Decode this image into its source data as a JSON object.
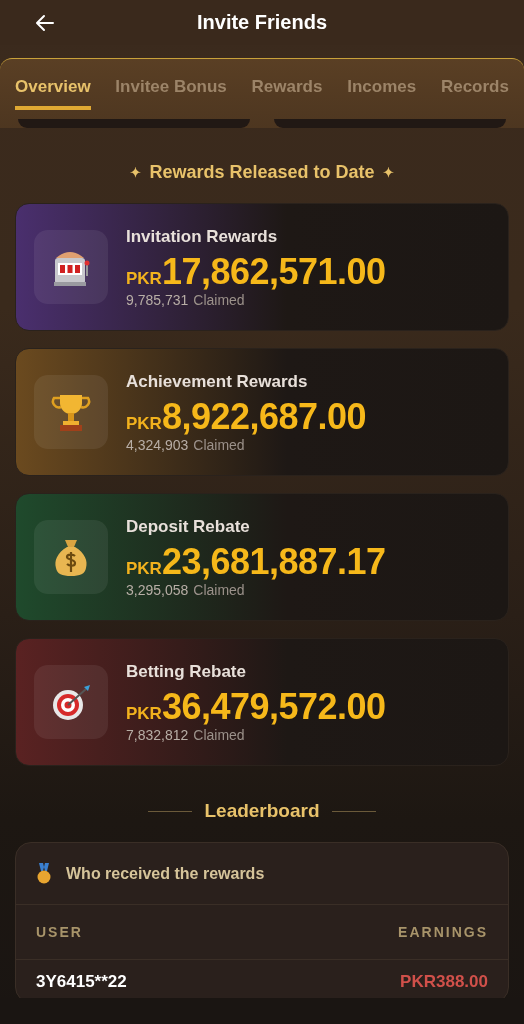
{
  "header": {
    "title": "Invite Friends"
  },
  "tabs": [
    {
      "label": "Overview",
      "selected": true
    },
    {
      "label": "Invitee Bonus",
      "selected": false
    },
    {
      "label": "Rewards",
      "selected": false
    },
    {
      "label": "Incomes",
      "selected": false
    },
    {
      "label": "Records",
      "selected": false
    }
  ],
  "released": {
    "title": "Rewards Released to Date",
    "star": "✦",
    "cards": [
      {
        "kind": "slot",
        "color": "#4a2f6e",
        "title": "Invitation Rewards",
        "currency": "PKR",
        "amount": "17,862,571.00",
        "count": "9,785,731",
        "count_label": "Claimed"
      },
      {
        "kind": "trophy",
        "color": "#6b4a1f",
        "title": "Achievement Rewards",
        "currency": "PKR",
        "amount": "8,922,687.00",
        "count": "4,324,903",
        "count_label": "Claimed"
      },
      {
        "kind": "moneybag",
        "color": "#1f4a2c",
        "title": "Deposit Rebate",
        "currency": "PKR",
        "amount": "23,681,887.17",
        "count": "3,295,058",
        "count_label": "Claimed"
      },
      {
        "kind": "target",
        "color": "#5a2222",
        "title": "Betting Rebate",
        "currency": "PKR",
        "amount": "36,479,572.00",
        "count": "7,832,812",
        "count_label": "Claimed"
      }
    ]
  },
  "leaderboard": {
    "title": "Leaderboard",
    "subtitle": "Who received the rewards",
    "columns": [
      "USER",
      "EARNINGS"
    ],
    "rows": [
      {
        "user": "3Y6415**22",
        "earnings": "PKR388.00"
      }
    ]
  }
}
